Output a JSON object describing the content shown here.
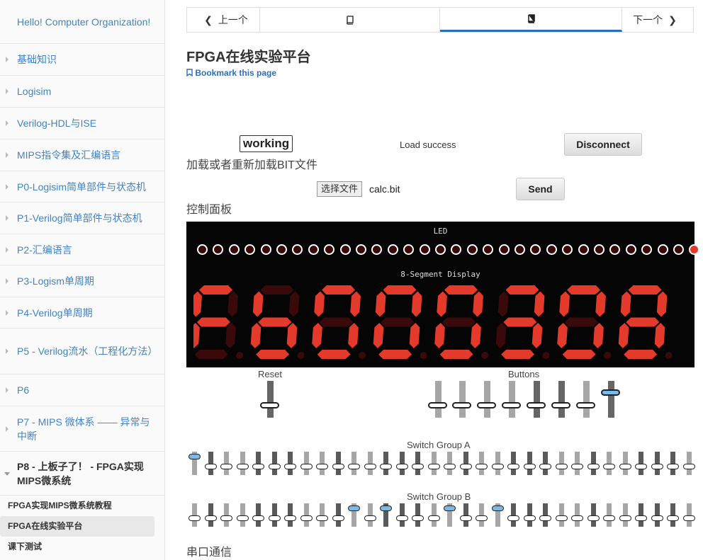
{
  "sidebar": {
    "items": [
      {
        "label": "Hello! Computer Organization!",
        "h": 62
      },
      {
        "label": "基础知识",
        "h": 45
      },
      {
        "label": "Logisim",
        "h": 45
      },
      {
        "label": "Verilog-HDL与ISE",
        "h": 45
      },
      {
        "label": "MIPS指令集及汇编语言",
        "h": 45
      },
      {
        "label": "P0-Logisim简单部件与状态机",
        "h": 44
      },
      {
        "label": "P1-Verilog简单部件与状态机",
        "h": 45
      },
      {
        "label": "P2-汇编语言",
        "h": 44
      },
      {
        "label": "P3-Logism单周期",
        "h": 45
      },
      {
        "label": "P4-Verilog单周期",
        "h": 44
      },
      {
        "label": "P5 - Verilog流水（工程化方法）",
        "h": 65
      },
      {
        "label": "P6",
        "h": 45
      },
      {
        "label": "P7 - MIPS 微体系 —— 异常与中断",
        "h": 64
      },
      {
        "label": "P8 - 上板子了！ - FPGA实现MIPS微系统",
        "h": 62,
        "open": true
      }
    ],
    "sub_items": [
      {
        "label": "FPGA实现MIPS微系统教程"
      },
      {
        "label": "FPGA在线实验平台",
        "active": true
      },
      {
        "label": "课下测试"
      }
    ]
  },
  "pager": {
    "prev": "上一个",
    "next": "下一个"
  },
  "page": {
    "title": "FPGA在线实验平台",
    "bookmark": "Bookmark this page",
    "status": "working",
    "load_status": "Load success",
    "disconnect": "Disconnect",
    "load_label": "加载或者重新加载BIT文件",
    "choose_file": "选择文件",
    "file_name": "calc.bit",
    "send": "Send",
    "control_panel": "控制面板",
    "serial": "串口通信"
  },
  "panel": {
    "led_title": "LED",
    "led_states": [
      0,
      0,
      0,
      0,
      0,
      0,
      0,
      0,
      0,
      0,
      0,
      0,
      0,
      0,
      0,
      0,
      0,
      0,
      0,
      0,
      0,
      0,
      0,
      0,
      0,
      0,
      0,
      0,
      0,
      0,
      0,
      1
    ],
    "display_title": "8-Segment Display",
    "digits": "Fb000308",
    "decimal_points": [
      1,
      1,
      1,
      1,
      1,
      1,
      1,
      1
    ],
    "reset_label": "Reset",
    "buttons_label": "Buttons",
    "buttons": [
      0,
      0,
      0,
      0,
      0,
      0,
      0,
      1
    ],
    "switch_a_label": "Switch Group A",
    "switch_a": [
      1,
      0,
      0,
      0,
      0,
      0,
      0,
      0,
      0,
      0,
      0,
      0,
      0,
      0,
      0,
      0,
      0,
      0,
      0,
      0,
      0,
      0,
      0,
      0,
      0,
      0,
      0,
      0,
      0,
      0,
      0,
      0
    ],
    "switch_b_label": "Switch Group B",
    "switch_b": [
      0,
      0,
      0,
      0,
      0,
      0,
      0,
      0,
      0,
      0,
      1,
      0,
      1,
      0,
      0,
      0,
      1,
      0,
      0,
      1,
      0,
      0,
      0,
      0,
      0,
      0,
      0,
      0,
      0,
      0,
      0,
      0
    ]
  },
  "colors": {
    "accent": "#2a6ebd",
    "segment_on": "#e43a2c",
    "segment_off": "#3a0a0a",
    "knob_on": "#7cb8e8"
  }
}
